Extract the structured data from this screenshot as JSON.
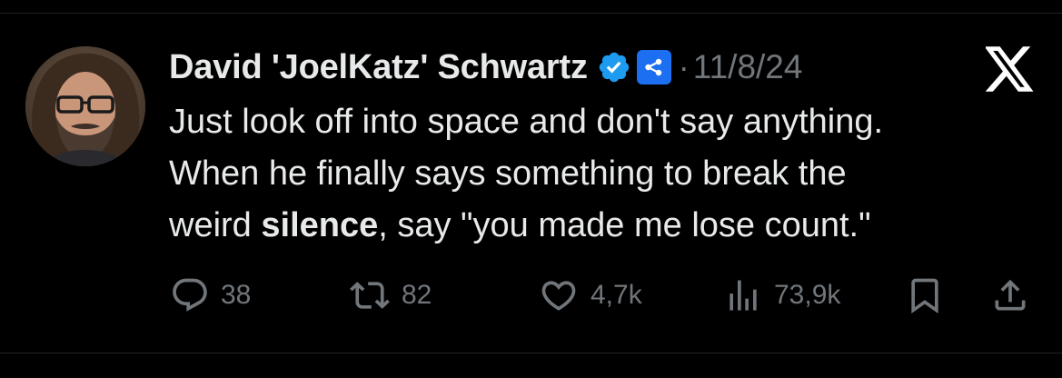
{
  "tweet": {
    "author_name": "David 'JoelKatz' Schwartz",
    "verified": true,
    "affiliate_badge": "ripple-logo-icon",
    "date": "11/8/24",
    "separator": "·",
    "body_lines": [
      {
        "segments": [
          {
            "text": "Just look off into space and don't say anything.",
            "bold": false
          }
        ]
      },
      {
        "segments": [
          {
            "text": "When he finally says something to break the",
            "bold": false
          }
        ]
      },
      {
        "segments": [
          {
            "text": "weird ",
            "bold": false
          },
          {
            "text": "silence",
            "bold": true
          },
          {
            "text": ", say \"you made me lose count.\"",
            "bold": false
          }
        ]
      }
    ],
    "metrics": {
      "replies": "38",
      "reposts": "82",
      "likes": "4,7k",
      "views": "73,9k"
    }
  },
  "colors": {
    "background": "#000000",
    "text_primary": "#e7e9ea",
    "text_secondary": "#71767b",
    "verified_blue": "#1d9bf0",
    "affiliate_blue": "#1d6ff2"
  }
}
